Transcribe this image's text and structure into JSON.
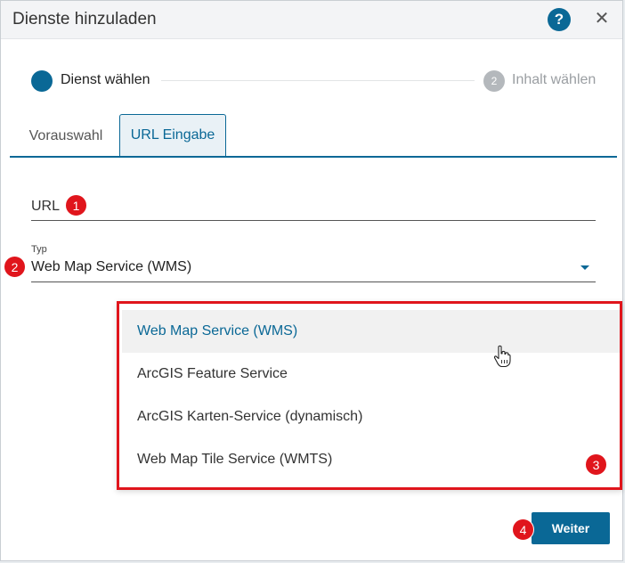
{
  "dialog": {
    "title": "Dienste hinzuladen",
    "help_label": "?",
    "close_label": "✕"
  },
  "stepper": {
    "step1_label": "Dienst wählen",
    "step2_number": "2",
    "step2_label": "Inhalt wählen"
  },
  "tabs": [
    {
      "label": "Vorauswahl",
      "active": false
    },
    {
      "label": "URL Eingabe",
      "active": true
    }
  ],
  "form": {
    "url_label": "URL",
    "typ_label": "Typ",
    "typ_value": "Web Map Service (WMS)"
  },
  "dropdown": {
    "options": [
      "Web Map Service (WMS)",
      "ArcGIS Feature Service",
      "ArcGIS Karten-Service (dynamisch)",
      "Web Map Tile Service (WMTS)"
    ],
    "selected_index": 0
  },
  "badges": [
    "1",
    "2",
    "3",
    "4"
  ],
  "footer": {
    "next_label": "Weiter"
  },
  "colors": {
    "accent": "#0a6896",
    "annotation_red": "#e0151c"
  }
}
